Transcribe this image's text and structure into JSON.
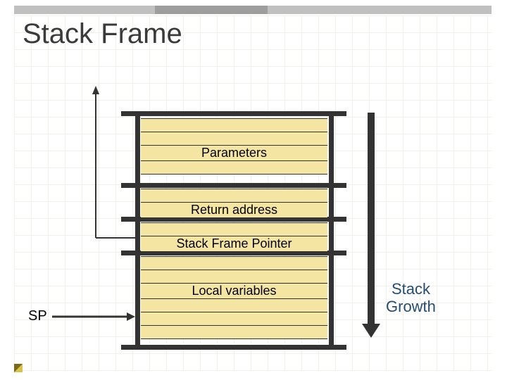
{
  "title": "Stack Frame",
  "regions": {
    "parameters": "Parameters",
    "return_address": "Return address",
    "frame_pointer": "Stack Frame Pointer",
    "local_vars": "Local variables"
  },
  "labels": {
    "sp": "SP",
    "growth_line1": "Stack",
    "growth_line2": "Growth"
  }
}
